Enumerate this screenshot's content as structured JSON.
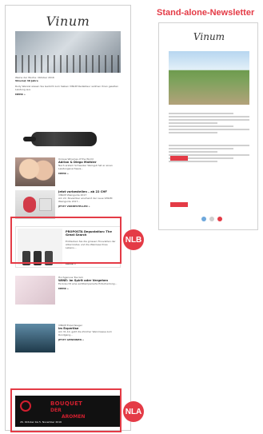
{
  "left_newsletter": {
    "logo": "Vinum",
    "hero_caption": "Weine der Woche: Oktober 2016",
    "hero_subcaption": "Vinum@ 40 Jahre",
    "items": [
      {
        "title": "Unique Wineries of the World",
        "subtitle": "Adrian & Diego Mathier",
        "body": "Nach erstem Schweizer Weingut hat er einen Leistungsnachweis...",
        "more": "MEHR »"
      },
      {
        "title": "Jetzt vorbestellen – ab 22 CHF",
        "subtitle": "VINUM Weinguide 2017",
        "body": "Am 22. November erscheint der neue VINUM Weinguide 2017...",
        "more": "JETZT VORBESTELLEN »"
      },
      {
        "title": "Hochgenuss Tourism",
        "subtitle": "WINE: Im Spirit oder Vergehen",
        "body": "Es braucht eine wohltemperierte Entscheidung...",
        "more": "MEHR »"
      },
      {
        "title": "VINUM Exportsieger",
        "subtitle": "im Expertise",
        "body": "Am 31.10. geht die Zürcher Weinmesse zum Rundgang...",
        "more": "JETZT GEWINNEN »"
      }
    ],
    "ad_top": {
      "title": "PROPOSTA Degustation: The Great Search",
      "body": "Entdecken Sie die grossen Trouvaillen der Albarinodes und die Weinlese Ihres Lebens...",
      "more": "MEHR »"
    },
    "ad_bottom": {
      "line1": "BOUQUET",
      "line2": "DER",
      "line3": "AROMEN",
      "date": "26. Oktober bis 5. November 2016"
    }
  },
  "markers": {
    "nlb": "NLB",
    "nla": "NLA"
  },
  "right_newsletter": {
    "title": "Stand-alone-Newsletter",
    "logo": "Vinum",
    "dots": [
      {
        "name": "dot-1",
        "color": "#6fa8dc"
      },
      {
        "name": "dot-2",
        "color": "#cfcfcf"
      },
      {
        "name": "dot-3",
        "color": "#e43b46"
      }
    ]
  },
  "colors": {
    "accent_red": "#e43b46"
  }
}
